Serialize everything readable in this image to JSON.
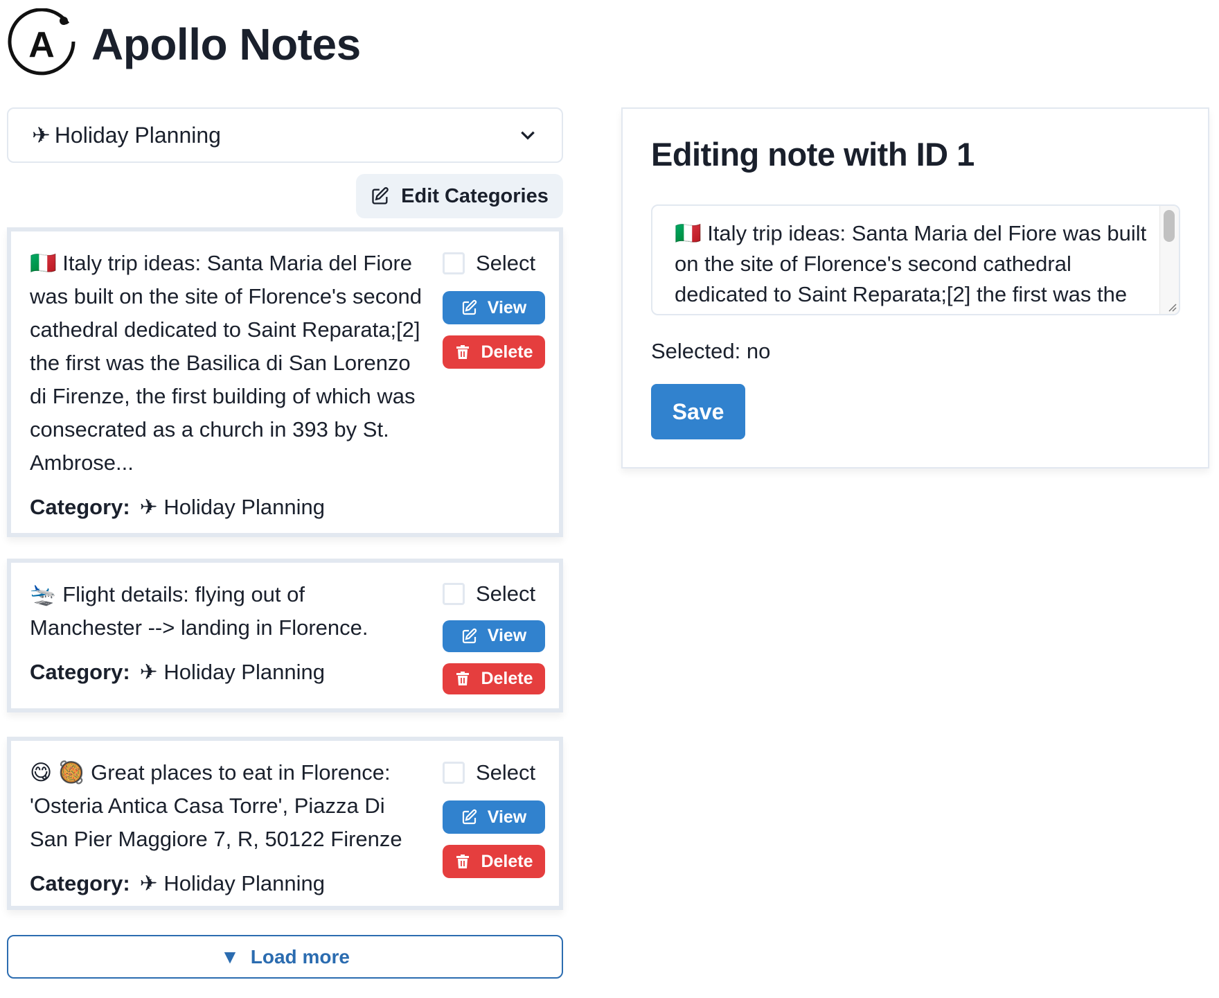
{
  "app": {
    "title": "Apollo Notes",
    "logo_letter": "A"
  },
  "category_select": {
    "icon": "✈",
    "selected": "Holiday Planning"
  },
  "edit_categories_label": "Edit Categories",
  "notes": [
    {
      "text": "🇮🇹 Italy trip ideas: Santa Maria del Fiore was built on the site of Florence's second cathedral dedicated to Saint Reparata;[2] the first was the Basilica di San Lorenzo di Firenze, the first building of which was consecrated as a church in 393 by St. Ambrose...",
      "category_label": "Category:",
      "category_icon": "✈",
      "category": "Holiday Planning",
      "select_label": "Select",
      "selected": false,
      "view_label": "View",
      "delete_label": "Delete"
    },
    {
      "text": "🛬 Flight details: flying out of Manchester --> landing in Florence.",
      "category_label": "Category:",
      "category_icon": "✈",
      "category": "Holiday Planning",
      "select_label": "Select",
      "selected": false,
      "view_label": "View",
      "delete_label": "Delete"
    },
    {
      "text": "😋 🥘 Great places to eat in Florence: 'Osteria Antica Casa Torre', Piazza Di San Pier Maggiore 7, R, 50122 Firenze",
      "category_label": "Category:",
      "category_icon": "✈",
      "category": "Holiday Planning",
      "select_label": "Select",
      "selected": false,
      "view_label": "View",
      "delete_label": "Delete"
    }
  ],
  "load_more": {
    "icon": "▼",
    "label": "Load more"
  },
  "editor": {
    "title": "Editing note with ID 1",
    "textarea_value": "🇮🇹 Italy trip ideas: Santa Maria del Fiore was built on the site of Florence's second cathedral dedicated to Saint Reparata;[2] the first was the Basilica di San Lorenzo di Firenze, the first building of which was consecrated as a church in 393 by St. Ambrose...",
    "selected_status": "Selected: no",
    "save_label": "Save"
  },
  "colors": {
    "primary": "#3182ce",
    "danger": "#e53e3e",
    "outline": "#2b6cb0",
    "text": "#1a202c",
    "border": "#e2e8f0",
    "secondary_bg": "#edf2f7"
  }
}
